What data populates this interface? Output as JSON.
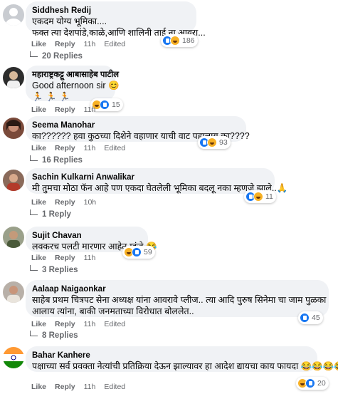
{
  "comments": [
    {
      "name": "Siddhesh Redij",
      "text": "एकदम योग्य भूमिका....",
      "text2": "फक्त त्या देशपांडे,काळे,आणि शालिनी ताई ना आवरा...",
      "like": "Like",
      "reply": "Reply",
      "time": "11h",
      "edited": "Edited",
      "count": "186",
      "replies": "20 Replies"
    },
    {
      "name": "महाराष्ट्रकट्टू आबासाहेब पाटील",
      "text": "Good afternoon sir 😊",
      "text2": "🏃 🏃 🏃",
      "like": "Like",
      "reply": "Reply",
      "time": "11h",
      "count": "15"
    },
    {
      "name": "Seema Manohar",
      "text": "का?????? हवा कुठच्या दिशेने वहाणार याची वाट पहालाय का????",
      "like": "Like",
      "reply": "Reply",
      "time": "11h",
      "edited": "Edited",
      "count": "93",
      "replies": "16 Replies"
    },
    {
      "name": "Sachin Kulkarni Anwalikar",
      "text": "मी तुमचा मोठा फॅन आहे पण एकदा घेतलेली भूमिका बदलू नका म्हणजे झाले..🙏",
      "like": "Like",
      "reply": "Reply",
      "time": "10h",
      "count": "11",
      "replies": "1 Reply"
    },
    {
      "name": "Sujit Chavan",
      "text": "लवकरच पलटी मारणार आहेत म्हंजे 😂",
      "like": "Like",
      "reply": "Reply",
      "time": "11h",
      "count": "59",
      "replies": "3 Replies"
    },
    {
      "name": "Aalaap Naigaonkar",
      "text": "साहेब प्रथम चित्रपट सेना अध्यक्ष यांना आवरावे प्लीज.. त्या आदि पुरुष सिनेमा चा जाम पुळका",
      "text2": "आलाय त्यांना, बाकी जनमताच्या विरोधात बोललेत..",
      "like": "Like",
      "reply": "Reply",
      "time": "11h",
      "edited": "Edited",
      "count": "45",
      "replies": "8 Replies"
    },
    {
      "name": "Bahar Kanhere",
      "text": "पक्षाच्या सर्व प्रवक्ता नेत्यांची प्रतिक्रिया देऊन झाल्यावर हा आदेश द्यायचा काय फायदा 😂😂😂😂",
      "like": "Like",
      "reply": "Reply",
      "time": "11h",
      "edited": "Edited",
      "count": "20"
    }
  ],
  "colors": {
    "bubble": "#f0f2f5",
    "meta": "#65676b",
    "text": "#050505",
    "like": "#1877f2",
    "haha": "#f7b125",
    "love": "#f33e58"
  }
}
